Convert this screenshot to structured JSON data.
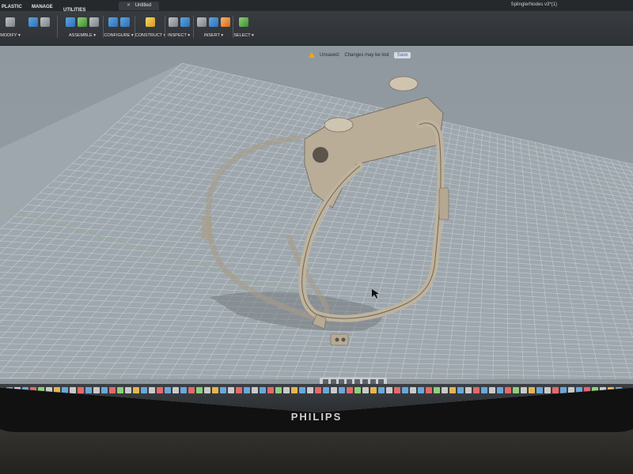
{
  "workspace": {
    "tab_plastic": "PLASTIC",
    "tab_manage": "MANAGE",
    "tab_utilities": "UTILITIES"
  },
  "document": {
    "tab_title": "Untitled",
    "app_name": "SplinglerNodes v3*(1)"
  },
  "toolbar": {
    "modify": "MODIFY ▾",
    "assemble": "ASSEMBLE ▾",
    "configure": "CONFIGURE ▾",
    "construct": "CONSTRUCT ▾",
    "inspect": "INSPECT ▾",
    "insert": "INSERT ▾",
    "select": "SELECT ▾"
  },
  "notification": {
    "status": "Unsaved:",
    "message": "Changes may be lost",
    "action": "Save"
  },
  "monitor": {
    "brand": "PHILIPS"
  },
  "colors": {
    "toolbar": "#3b3f43",
    "viewport": "#8f989f",
    "grid_line": "#c5ccd1",
    "model": "#b7ab96",
    "warning": "#f2a900"
  }
}
